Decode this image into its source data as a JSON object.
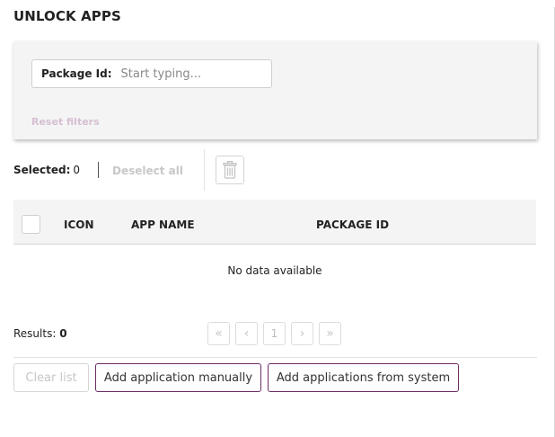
{
  "page": {
    "title": "UNLOCK APPS"
  },
  "filters": {
    "package_id_label": "Package Id:",
    "package_id_placeholder": "Start typing...",
    "package_id_value": "",
    "reset_label": "Reset filters"
  },
  "selection": {
    "selected_label": "Selected:",
    "selected_count": "0",
    "deselect_all_label": "Deselect all",
    "delete_icon": "trash-icon"
  },
  "table": {
    "columns": [
      "ICON",
      "APP NAME",
      "PACKAGE ID"
    ],
    "empty_text": "No data available"
  },
  "results": {
    "label": "Results:",
    "count": "0"
  },
  "pagination": {
    "first": "«",
    "prev": "‹",
    "current_page": "1",
    "next": "›",
    "last": "»"
  },
  "actions": {
    "clear_list": "Clear list",
    "add_manual": "Add application manually",
    "add_system": "Add applications from system"
  },
  "colors": {
    "accent": "#6b2c63",
    "panel_bg": "#f4f4f4",
    "disabled_text": "#c6c6c6",
    "reset_link": "#d6bfd3"
  }
}
